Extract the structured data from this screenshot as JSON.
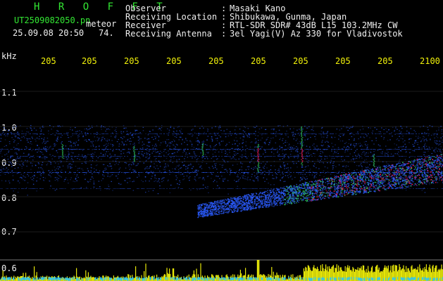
{
  "header": {
    "brand": "H R O F F T",
    "filename": "UT2509082050.pn",
    "type_tag": "meteor",
    "datetime": "25.09.08 20:50",
    "count": "74."
  },
  "meta": [
    {
      "key": "Observer",
      "value": "Masaki Kano"
    },
    {
      "key": "Receiving Location",
      "value": "Shibukawa, Gunma, Japan"
    },
    {
      "key": "Receiver",
      "value": "RTL-SDR SDR# 43dB L15 103.2MHz CW"
    },
    {
      "key": "Receiving Antenna",
      "value": "3el Yagi(V) Az 330 for Vladivostok"
    }
  ],
  "x_axis": {
    "ticks": [
      "205",
      "205",
      "205",
      "205",
      "205",
      "205",
      "205",
      "205",
      "205",
      "205",
      "2100"
    ]
  },
  "y_axis": {
    "unit": "kHz",
    "ticks": [
      "1.1",
      "1.0",
      "0.9",
      "0.8",
      "0.7",
      "0.6"
    ]
  },
  "colors": {
    "background": "#000000",
    "text_label": "#f0f0f0",
    "tick_label": "#f2f20a",
    "brand": "#33e833",
    "noise_blue": "#2b5cff",
    "signal_green": "#30d060",
    "signal_red": "#ff2060",
    "level_cyan": "#27c7ff",
    "level_yellow": "#f2f20a"
  }
}
